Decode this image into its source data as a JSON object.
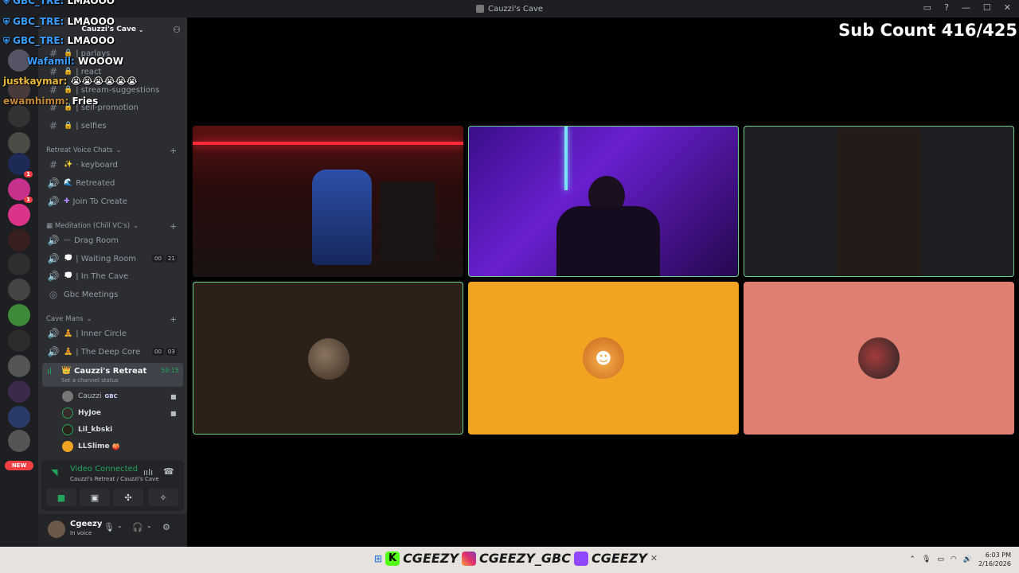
{
  "window": {
    "title": "Cauzzi's Cave"
  },
  "overlay": {
    "sub_count": "Sub Count 416/425"
  },
  "chat": [
    {
      "user": "GBC_TRE:",
      "message": "LMAOOO",
      "user_color": "#3b9eff"
    },
    {
      "user": "GBC_TRE:",
      "message": "LMAOOO",
      "user_color": "#3b9eff"
    },
    {
      "user": "GBC_TRE:",
      "message": "LMAOOO",
      "user_color": "#3b9eff"
    },
    {
      "user": "Wafamil:",
      "message": "WOOOW",
      "user_color": "#3b9eff"
    },
    {
      "user": "justkaymar:",
      "message": "😭😭😭😭😭😭",
      "user_color": "#e8b83a"
    },
    {
      "user": "ewamhimm:",
      "message": "Fries",
      "user_color": "#c48a3a"
    }
  ],
  "server": {
    "name": "Cauzzi's Cave"
  },
  "channels_top": [
    {
      "name": "| parlays"
    },
    {
      "name": "| react"
    },
    {
      "name": "| stream-suggestions"
    },
    {
      "name": "| self-promotion"
    },
    {
      "name": "| selfies"
    }
  ],
  "categories": {
    "retreat": "Retreat Voice Chats",
    "meditation": "Meditation (Chill VC's)",
    "cave_mans": "Cave Mans"
  },
  "retreat_channels": [
    {
      "name": "· keyboard"
    },
    {
      "name": "Retreated"
    },
    {
      "name": "Join To Create"
    }
  ],
  "meditation_channels": [
    {
      "name": "Drag Room"
    },
    {
      "name": "| Waiting Room",
      "count_a": "00",
      "count_b": "21"
    },
    {
      "name": "| In The Cave"
    },
    {
      "name": "Gbc Meetings"
    }
  ],
  "cave_channels": [
    {
      "name": "| Inner Circle"
    },
    {
      "name": "| The Deep Core",
      "count_a": "00",
      "count_b": "03"
    }
  ],
  "active_channel": {
    "name": "Cauzzi's Retreat",
    "time": "59:15",
    "status": "Set a channel status"
  },
  "voice_users": [
    {
      "name": "Cauzzi",
      "tag": "GBC",
      "camera": true
    },
    {
      "name": "HyJoe",
      "camera": true
    },
    {
      "name": "Lil_kbski",
      "camera": false
    },
    {
      "name": "LLSlime",
      "camera": false
    }
  ],
  "voice_panel": {
    "status": "Video Connected",
    "location": "Cauzzi's Retreat / Cauzzi's Cave"
  },
  "user": {
    "name": "Cgeezy",
    "status": "In voice"
  },
  "rail": {
    "new_label": "NEW"
  },
  "taskbar": {
    "handles": [
      "CGEEZY",
      "CGEEZY_GBC",
      "CGEEZY"
    ],
    "time": "6:03 PM",
    "date": "2/16/2026"
  },
  "tiles": [
    {
      "type": "video",
      "scene": "gaming-chair-red-room",
      "speaking": false
    },
    {
      "type": "video",
      "scene": "purple-room-person",
      "speaking": true
    },
    {
      "type": "video",
      "scene": "dark-doorway",
      "speaking": true
    },
    {
      "type": "avatar",
      "bg": "#2b2119",
      "speaking": true
    },
    {
      "type": "avatar",
      "bg": "#f0a422",
      "speaking": false
    },
    {
      "type": "avatar",
      "bg": "#de7f72",
      "speaking": false
    }
  ],
  "colors": {
    "accent_green": "#23a55a",
    "speaking_border": "#6fd28a",
    "danger": "#f23f43"
  }
}
